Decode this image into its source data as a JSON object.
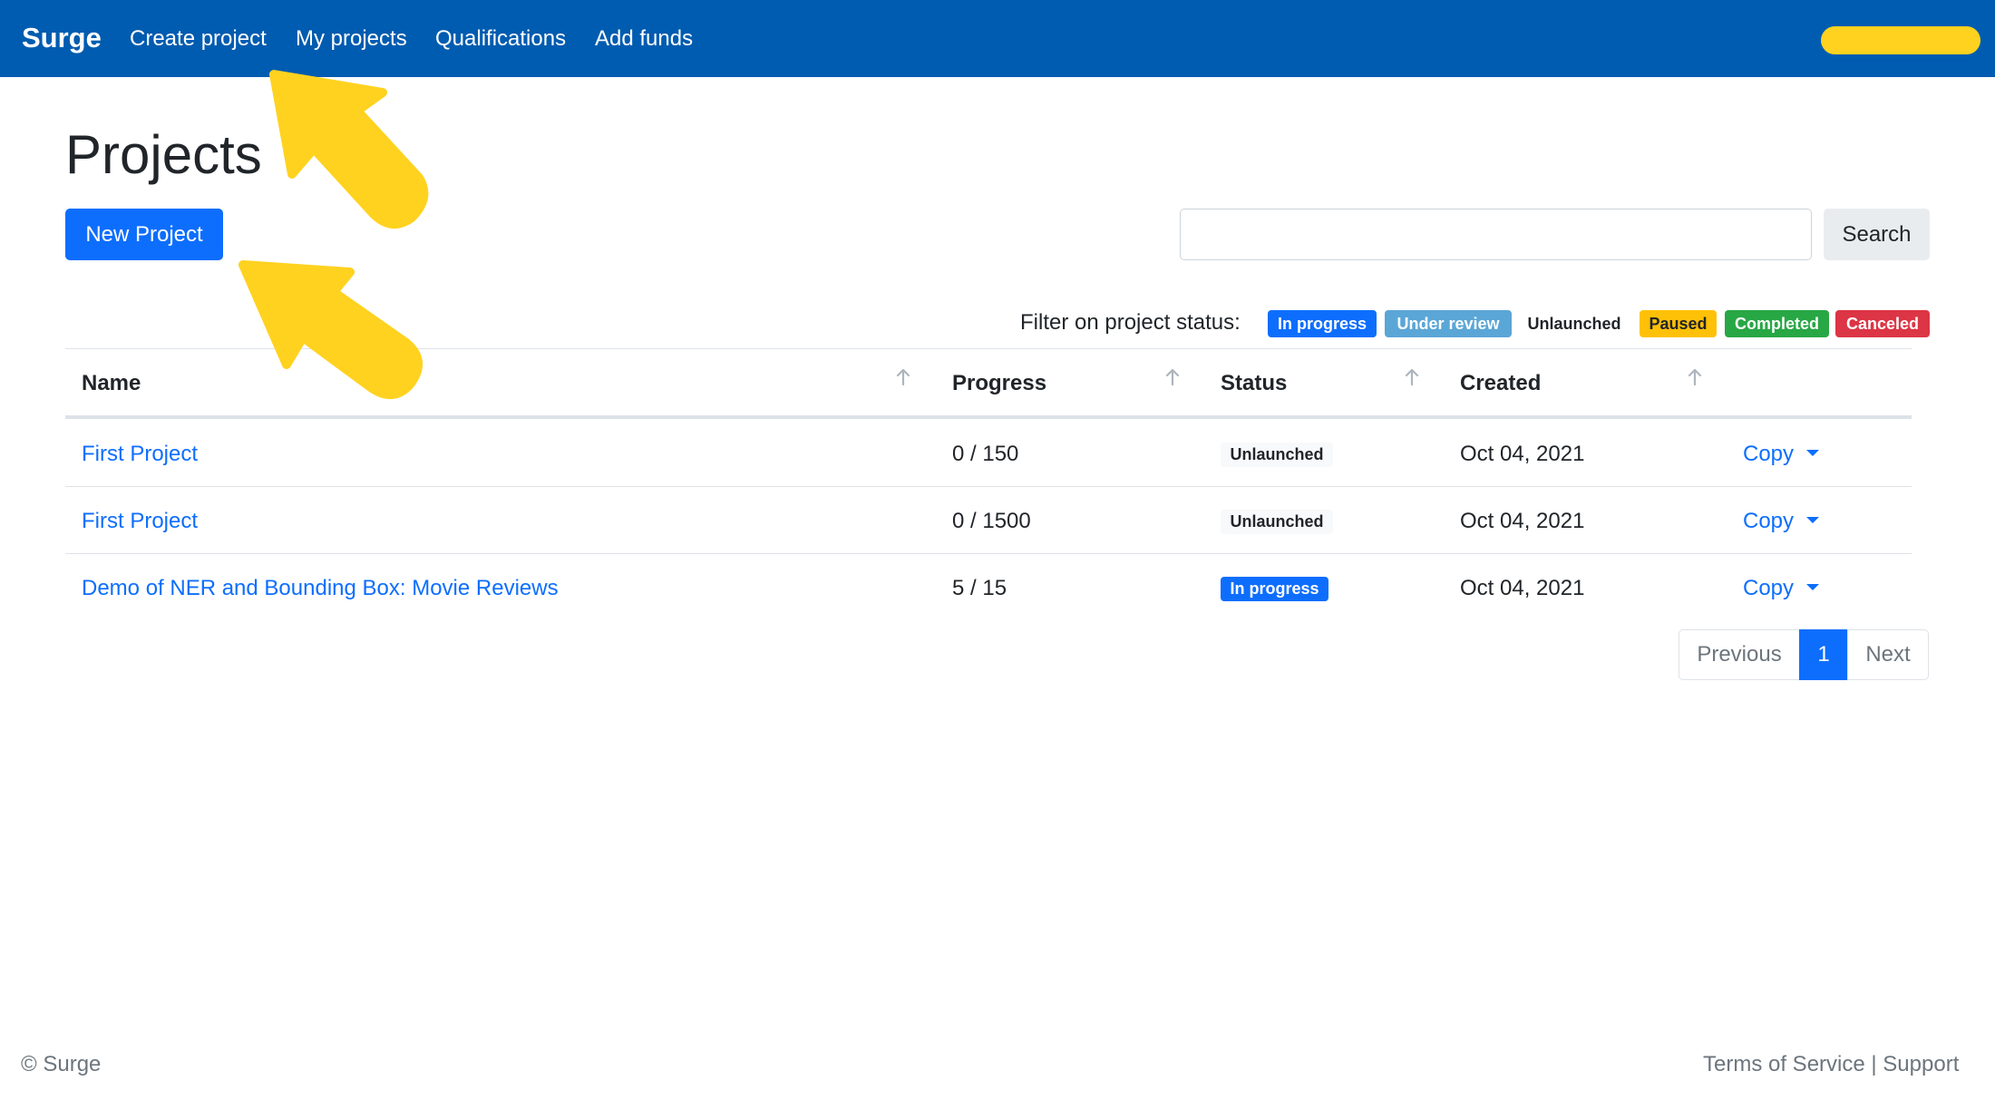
{
  "navbar": {
    "brand": "Surge",
    "links": [
      "Create project",
      "My projects",
      "Qualifications",
      "Add funds"
    ],
    "bg_color": "#005cb0",
    "user_pill_color": "#ffd21f"
  },
  "page": {
    "title": "Projects",
    "new_project_label": "New Project",
    "search_value": "",
    "search_label": "Search"
  },
  "filter": {
    "label": "Filter on project status:",
    "statuses": [
      {
        "label": "In progress",
        "color": "#0d6efd",
        "text_color": "#ffffff"
      },
      {
        "label": "Under review",
        "color": "#5aa6d6",
        "text_color": "#ffffff"
      },
      {
        "label": "Unlaunched",
        "color": "#ffffff",
        "text_color": "#212529"
      },
      {
        "label": "Paused",
        "color": "#ffc107",
        "text_color": "#212529"
      },
      {
        "label": "Completed",
        "color": "#28a745",
        "text_color": "#ffffff"
      },
      {
        "label": "Canceled",
        "color": "#dc3545",
        "text_color": "#ffffff"
      }
    ]
  },
  "table": {
    "headers": [
      "Name",
      "Progress",
      "Status",
      "Created"
    ],
    "sort_icon": "arrow-up-icon",
    "rows": [
      {
        "name": "First Project",
        "progress": "0 / 150",
        "status": "Unlaunched",
        "created": "Oct 04, 2021",
        "action": "Copy"
      },
      {
        "name": "First Project",
        "progress": "0 / 1500",
        "status": "Unlaunched",
        "created": "Oct 04, 2021",
        "action": "Copy"
      },
      {
        "name": "Demo of NER and Bounding Box: Movie Reviews",
        "progress": "5 / 15",
        "status": "In progress",
        "created": "Oct 04, 2021",
        "action": "Copy"
      }
    ]
  },
  "pagination": {
    "previous": "Previous",
    "current": "1",
    "next": "Next"
  },
  "footer": {
    "copyright": "© Surge",
    "terms": "Terms of Service",
    "separator": "|",
    "support": "Support"
  },
  "annotations": {
    "arrow_color": "#ffd21f",
    "arrow_targets": [
      "create-project-link",
      "new-project-button"
    ]
  }
}
